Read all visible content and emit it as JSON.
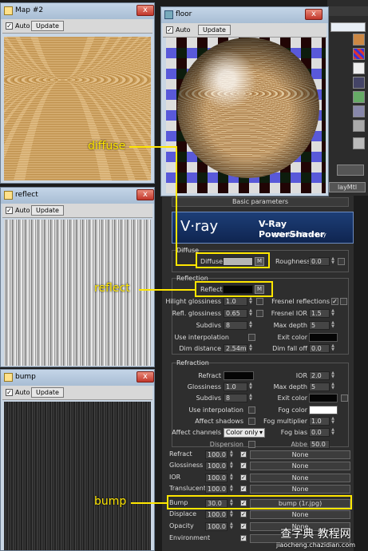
{
  "map2": {
    "title": "Map #2",
    "auto": "Auto",
    "update": "Update",
    "close": "x"
  },
  "reflect_win": {
    "title": "reflect",
    "auto": "Auto",
    "update": "Update",
    "close": "x"
  },
  "bump_win": {
    "title": "bump",
    "auto": "Auto",
    "update": "Update",
    "close": "x"
  },
  "floor_win": {
    "title": "floor",
    "auto": "Auto",
    "update": "Update",
    "close": "x"
  },
  "panel": {
    "basic_parameters": "Basic parameters",
    "banner_logo": "V·ray",
    "banner_title": "V-Ray PowerShader",
    "banner_sub": "optimized for V-Ray",
    "diffuse_group": "Diffuse",
    "diffuse": "Diffuse",
    "roughness": "Roughness",
    "roughness_val": "0.0",
    "reflection_group": "Reflection",
    "reflect": "Reflect",
    "hilight": "Hilight glossiness",
    "hilight_val": "1.0",
    "fresnel": "Fresnel reflections",
    "refl_gloss": "Refl. glossiness",
    "refl_gloss_val": "0.65",
    "fresnel_ior": "Fresnel IOR",
    "fresnel_ior_val": "1.5",
    "subdivs": "Subdivs",
    "subdivs_val": "8",
    "max_depth": "Max depth",
    "max_depth_val": "5",
    "use_interp": "Use interpolation",
    "exit_color": "Exit color",
    "dim_distance": "Dim distance",
    "dim_distance_val": "2.54m",
    "dim_falloff": "Dim fall off",
    "dim_falloff_val": "0.0",
    "refraction_group": "Refraction",
    "refract": "Refract",
    "ior": "IOR",
    "ior_val": "2.0",
    "glossiness": "Glossiness",
    "glossiness_val": "1.0",
    "r_max_depth": "Max depth",
    "r_max_depth_val": "5",
    "r_subdivs": "Subdivs",
    "r_subdivs_val": "8",
    "r_exit_color": "Exit color",
    "r_use_interp": "Use interpolation",
    "fog_color": "Fog color",
    "affect_shadows": "Affect shadows",
    "fog_mult": "Fog multiplier",
    "fog_mult_val": "1.0",
    "affect_channels": "Affect channels",
    "affect_channels_val": "Color only",
    "fog_bias": "Fog bias",
    "fog_bias_val": "0.0",
    "dispersion": "Dispersion",
    "abbe": "Abbe",
    "abbe_val": "50.0",
    "m": "M"
  },
  "maps": [
    {
      "name": "Refract",
      "amount": "100.0",
      "slot": "None"
    },
    {
      "name": "Glossiness",
      "amount": "100.0",
      "slot": "None"
    },
    {
      "name": "IOR",
      "amount": "100.0",
      "slot": "None"
    },
    {
      "name": "Translucent",
      "amount": "100.0",
      "slot": "None"
    },
    {
      "name": "Bump",
      "amount": "30.0",
      "slot": "bump (1r.jpg)"
    },
    {
      "name": "Displace",
      "amount": "100.0",
      "slot": "None"
    },
    {
      "name": "Opacity",
      "amount": "100.0",
      "slot": "None"
    },
    {
      "name": "Environment",
      "amount": "",
      "slot": ""
    }
  ],
  "annotations": {
    "diffuse": "diffuse",
    "reflect": "reflect",
    "bump": "bump"
  },
  "top_right": {
    "label": "layMtl"
  },
  "watermark": {
    "line1": "查字典 教程网",
    "line2": "jiaocheng.chazidian.com"
  },
  "colors": {
    "annotation": "#ffe600"
  }
}
